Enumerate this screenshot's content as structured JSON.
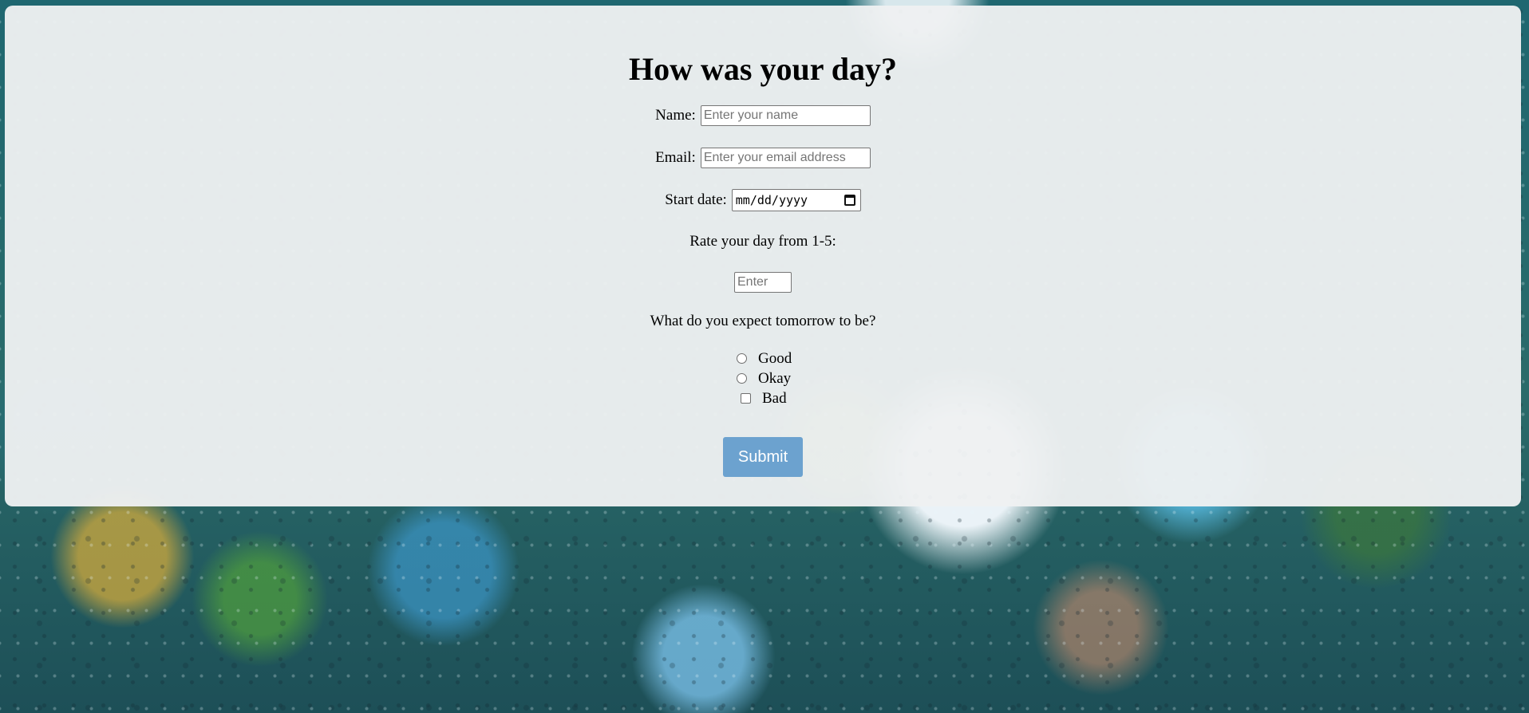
{
  "form": {
    "title": "How was your day?",
    "name": {
      "label": "Name:",
      "placeholder": "Enter your name"
    },
    "email": {
      "label": "Email:",
      "placeholder": "Enter your email address"
    },
    "start_date": {
      "label": "Start date:",
      "format": "mm/dd/yyyy"
    },
    "rating": {
      "label": "Rate your day from 1-5:",
      "placeholder": "Enter"
    },
    "tomorrow": {
      "question": "What do you expect tomorrow to be?",
      "options": [
        "Good",
        "Okay",
        "Bad"
      ]
    },
    "submit_label": "Submit"
  },
  "colors": {
    "submit_button": "#6ca2cf",
    "card_background": "#eef0f1"
  }
}
